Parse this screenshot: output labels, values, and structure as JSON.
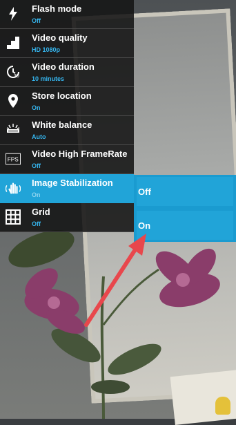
{
  "settings": [
    {
      "icon": "flash-icon",
      "title": "Flash mode",
      "value": "Off"
    },
    {
      "icon": "video-quality-icon",
      "title": "Video quality",
      "value": "HD 1080p"
    },
    {
      "icon": "timer-icon",
      "title": "Video duration",
      "value": "10 minutes"
    },
    {
      "icon": "location-pin-icon",
      "title": "Store location",
      "value": "On"
    },
    {
      "icon": "white-balance-icon",
      "title": "White balance",
      "value": "Auto"
    },
    {
      "icon": "fps-icon",
      "icon_text": "FPS",
      "title": "Video High FrameRate",
      "value": "Off"
    },
    {
      "icon": "hand-stabilization-icon",
      "title": "Image Stabilization",
      "value": "On"
    },
    {
      "icon": "grid-icon",
      "title": "Grid",
      "value": "Off"
    }
  ],
  "dropdown": {
    "options": [
      "Off",
      "On"
    ],
    "selected": "On"
  },
  "colors": {
    "accent": "#21a4d8",
    "value_text": "#35b5ee",
    "panel_bg": "#141414",
    "annotation_arrow": "#e8474c"
  }
}
